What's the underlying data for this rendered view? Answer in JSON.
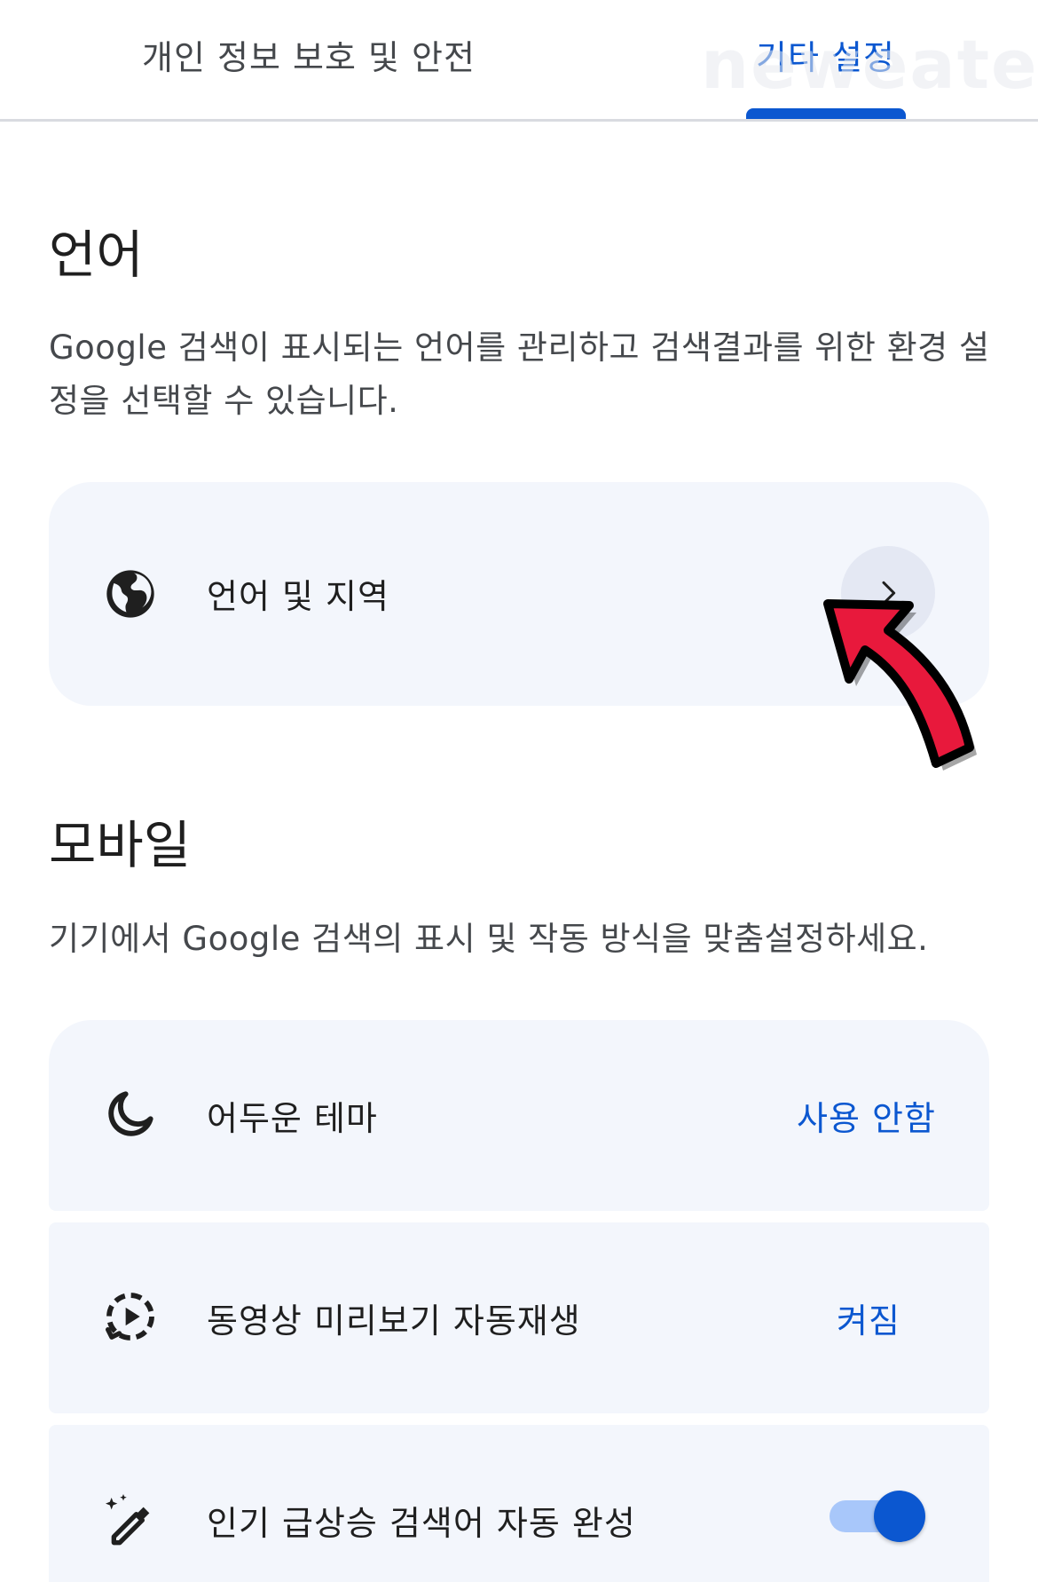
{
  "tabs": [
    {
      "label": "개인 정보 보호 및 안전",
      "selected": false
    },
    {
      "label": "기타 설정",
      "selected": true
    }
  ],
  "watermark": "neweater",
  "language": {
    "title": "언어",
    "description": "Google 검색이 표시되는 언어를 관리하고 검색결과를 위한 환경 설정을 선택할 수 있습니다.",
    "item": {
      "label": "언어 및 지역",
      "icon": "globe-icon",
      "action_icon": "chevron-right-icon"
    }
  },
  "mobile": {
    "title": "모바일",
    "description": "기기에서 Google 검색의 표시 및 작동 방식을 맞춤설정하세요.",
    "items": [
      {
        "label": "어두운 테마",
        "value": "사용 안함",
        "icon": "moon-icon"
      },
      {
        "label": "동영상 미리보기 자동재생",
        "value": "켜짐",
        "icon": "video-autoplay-icon"
      },
      {
        "label": "인기 급상승 검색어 자동 완성",
        "toggle_on": true,
        "icon": "magic-wand-icon"
      }
    ]
  },
  "colors": {
    "accent": "#0b57d0",
    "card_bg": "#f3f6fc",
    "toggle_track": "#a8c7fa",
    "annotation_arrow": "#e8193c"
  }
}
